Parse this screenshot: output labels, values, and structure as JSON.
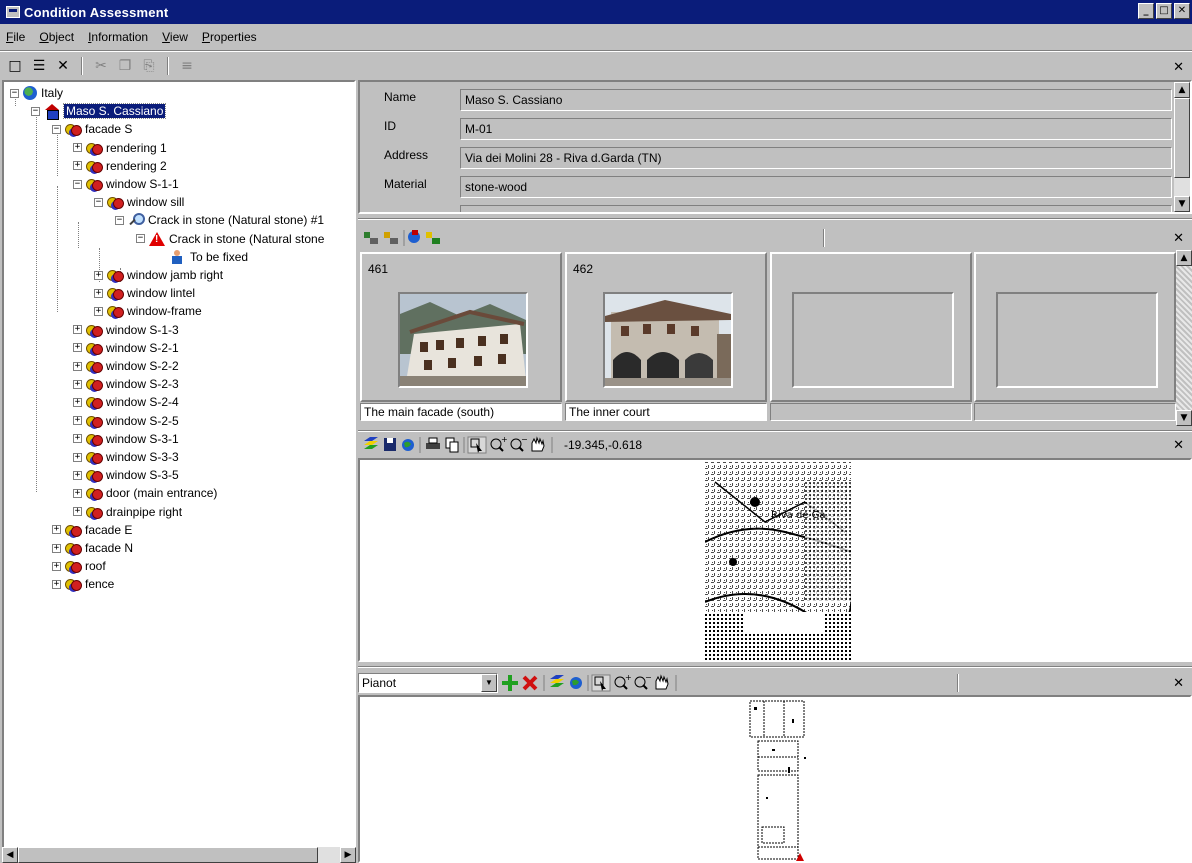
{
  "window": {
    "title": "Condition Assessment",
    "btn_min": "_",
    "btn_max": "□",
    "btn_close": "✕"
  },
  "menu": [
    {
      "label": "File",
      "key": "F",
      "rest": "ile"
    },
    {
      "label": "Object",
      "key": "O",
      "rest": "bject"
    },
    {
      "label": "Information",
      "key": "I",
      "rest": "nformation"
    },
    {
      "label": "View",
      "key": "V",
      "rest": "iew"
    },
    {
      "label": "Properties",
      "key": "P",
      "rest": "roperties"
    }
  ],
  "toolbar": {
    "icons": [
      "new-icon",
      "properties-icon",
      "delete-icon",
      "cut-icon",
      "copy-icon",
      "paste-icon",
      "tree-icon"
    ],
    "glyphs": {
      "new": "□",
      "properties": "☰",
      "delete": "✕",
      "cut": "✂",
      "copy": "❐",
      "paste": "⎘",
      "tree": "≡"
    }
  },
  "tree": [
    {
      "label": "Italy",
      "icon": "globe",
      "expander": "−"
    },
    {
      "label": "Maso S. Cassiano",
      "icon": "house",
      "expander": "−",
      "selected": true
    },
    {
      "label": "facade S",
      "icon": "obj",
      "expander": "−"
    },
    {
      "label": "rendering 1",
      "icon": "obj",
      "expander": "+"
    },
    {
      "label": "rendering 2",
      "icon": "obj",
      "expander": "+"
    },
    {
      "label": "window S-1-1",
      "icon": "obj",
      "expander": "−"
    },
    {
      "label": "window sill",
      "icon": "obj",
      "expander": "−"
    },
    {
      "label": "Crack in stone (Natural stone) #1",
      "icon": "magnify",
      "expander": "−"
    },
    {
      "label": "Crack in stone (Natural stone",
      "icon": "warn",
      "expander": "−"
    },
    {
      "label": "To be fixed",
      "icon": "worker",
      "expander": ""
    },
    {
      "label": "window jamb right",
      "icon": "obj",
      "expander": "+"
    },
    {
      "label": "window lintel",
      "icon": "obj",
      "expander": "+"
    },
    {
      "label": "window-frame",
      "icon": "obj",
      "expander": "+"
    },
    {
      "label": "window S-1-3",
      "icon": "obj",
      "expander": "+"
    },
    {
      "label": "window S-2-1",
      "icon": "obj",
      "expander": "+"
    },
    {
      "label": "window S-2-2",
      "icon": "obj",
      "expander": "+"
    },
    {
      "label": "window S-2-3",
      "icon": "obj",
      "expander": "+"
    },
    {
      "label": "window S-2-4",
      "icon": "obj",
      "expander": "+"
    },
    {
      "label": "window S-2-5",
      "icon": "obj",
      "expander": "+"
    },
    {
      "label": "window S-3-1",
      "icon": "obj",
      "expander": "+"
    },
    {
      "label": "window S-3-3",
      "icon": "obj",
      "expander": "+"
    },
    {
      "label": "window S-3-5",
      "icon": "obj",
      "expander": "+"
    },
    {
      "label": "door (main entrance)",
      "icon": "obj",
      "expander": "+"
    },
    {
      "label": "drainpipe right",
      "icon": "obj",
      "expander": "+"
    },
    {
      "label": "facade E",
      "icon": "obj",
      "expander": "+"
    },
    {
      "label": "facade N",
      "icon": "obj",
      "expander": "+"
    },
    {
      "label": "roof",
      "icon": "obj",
      "expander": "+"
    },
    {
      "label": "fence",
      "icon": "obj",
      "expander": "+"
    }
  ],
  "properties": [
    {
      "label": "Name",
      "value": "Maso S. Cassiano"
    },
    {
      "label": "ID",
      "value": "M-01"
    },
    {
      "label": "Address",
      "value": "Via dei Molini 28 - Riva d.Garda (TN)"
    },
    {
      "label": "Material",
      "value": "stone-wood"
    }
  ],
  "photos": [
    {
      "number": "461",
      "caption": "The main facade (south)"
    },
    {
      "number": "462",
      "caption": "The inner court"
    },
    {
      "number": "",
      "caption": ""
    },
    {
      "number": "",
      "caption": ""
    }
  ],
  "map_toolbar": {
    "coordinates": "-19.345,-0.618"
  },
  "plan_toolbar": {
    "layer": "Pianot",
    "dropdown_glyph": "▼"
  },
  "scroll_glyphs": {
    "up": "▲",
    "down": "▼",
    "left": "◀",
    "right": "▶"
  },
  "close_glyph": "✕",
  "colors": {
    "titlebar": "#0a1c7a",
    "face": "#c0c0c0",
    "selection": "#0a1c7a"
  }
}
